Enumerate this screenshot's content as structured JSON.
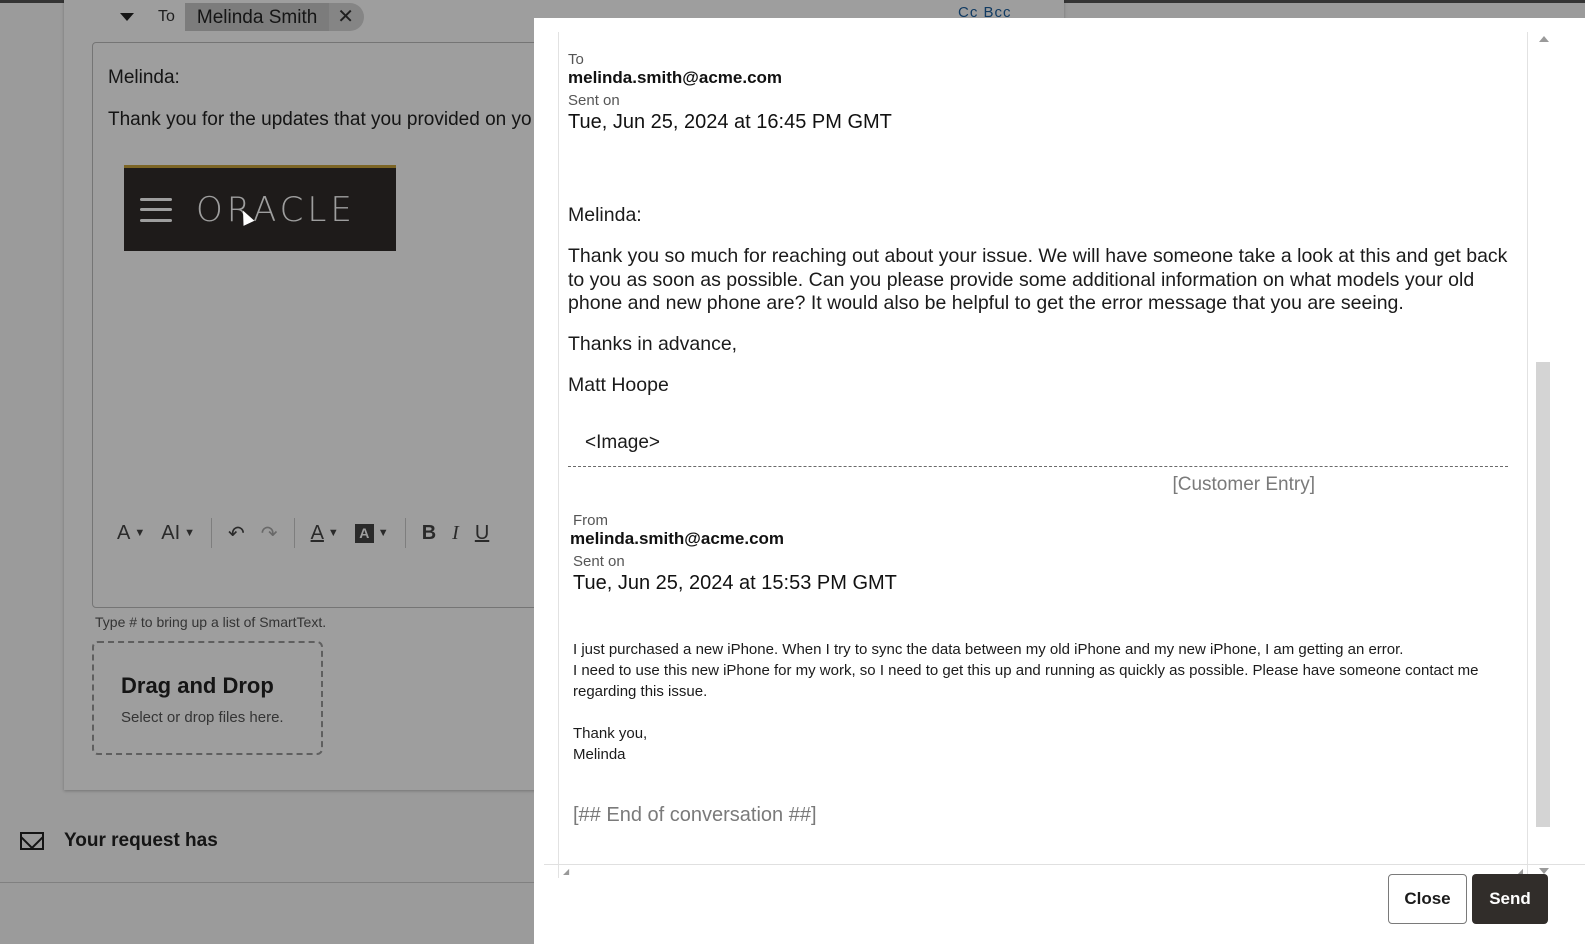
{
  "compose": {
    "to_label": "To",
    "recipient_name": "Melinda Smith",
    "remove_glyph": "✕",
    "cc_bcc": "Cc  Bcc",
    "body_greeting": "Melinda:",
    "body_line": "Thank you for the updates that you provided on yo",
    "logo_text": "ORACLE",
    "toolbar": {
      "text_style": "A⁲",
      "font_size": "AI",
      "undo": "↶",
      "redo": "↷",
      "font_color": "A",
      "highlight": "A",
      "bold": "B",
      "italic": "I",
      "underline": "U"
    },
    "smarttext_hint": "Type # to bring up a list of SmartText.",
    "dropzone_title": "Drag and Drop",
    "dropzone_subtitle": "Select or drop files here.",
    "request_text": "Your request has"
  },
  "dialog": {
    "reply": {
      "to_label": "To",
      "to_email": "melinda.smith@acme.com",
      "sent_label": "Sent on",
      "sent_date": "Tue, Jun 25, 2024 at 16:45 PM GMT",
      "greeting": "Melinda:",
      "paragraph": "Thank you so much for reaching out about your issue.  We will have someone take a look at this and get back to you as soon as possible. Can you please provide some additional information on what models your old phone and new phone are? It would also be helpful to get the error message that you are seeing.",
      "thanks": "Thanks in advance,",
      "signature": "Matt Hoope",
      "image_placeholder": "<Image>"
    },
    "customer_entry_label": "[Customer Entry]",
    "customer": {
      "from_label": "From",
      "from_email": "melinda.smith@acme.com",
      "sent_label": "Sent on",
      "sent_date": "Tue, Jun 25, 2024 at 15:53 PM GMT",
      "line1": "I just purchased a new iPhone. When I try to sync the data between my old iPhone and my new iPhone, I am getting an error.",
      "line2": "I need to use this new iPhone for my work, so I need to get this up and running as quickly as possible. Please have someone contact me regarding this issue.",
      "closing": "Thank you,",
      "name": "Melinda"
    },
    "end_of_conversation": "[## End of conversation ##]",
    "close_label": "Close",
    "send_label": "Send"
  }
}
